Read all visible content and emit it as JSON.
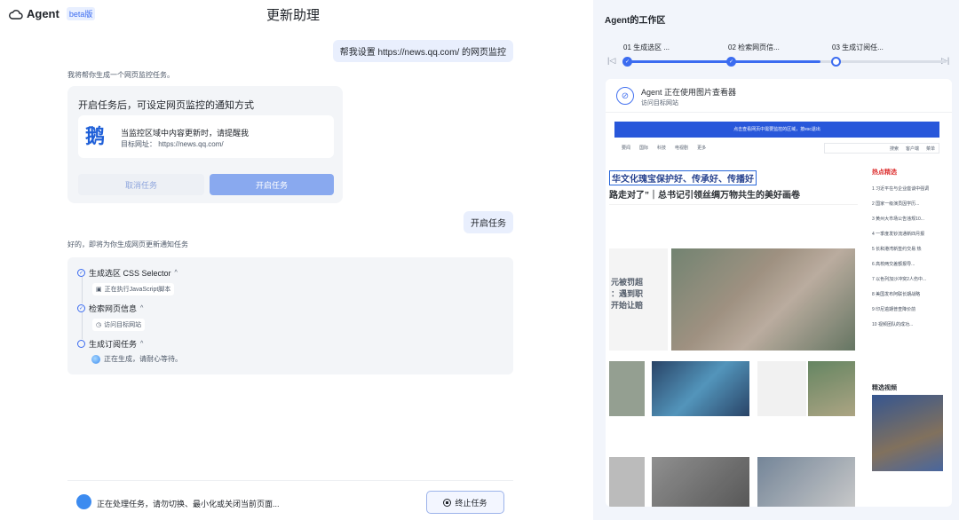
{
  "brand": {
    "name": "Agent",
    "badge": "beta版"
  },
  "page_title": "更新助理",
  "chat": {
    "user_msg_1": "帮我设置 https://news.qq.com/ 的网页监控",
    "bot_msg_1": "我将帮你生成一个网页监控任务。",
    "card": {
      "title": "开启任务后，可设定网页监控的通知方式",
      "logo_text": "鹅",
      "line1": "当监控区域中内容更新时，请提醒我",
      "line2": "目标网址：  https://news.qq.com/",
      "cancel_label": "取消任务",
      "start_label": "开启任务"
    },
    "user_msg_2": "开启任务",
    "bot_msg_2": "好的，即将为你生成网页更新通知任务",
    "steps": [
      {
        "label": "生成选区 CSS Selector",
        "sub": "正在执行JavaScript脚本",
        "done": true
      },
      {
        "label": "检索网页信息",
        "sub": "访问目标网站",
        "done": true
      },
      {
        "label": "生成订阅任务",
        "sub": "正在生成，请耐心等待。",
        "done": false
      }
    ]
  },
  "bottom": {
    "status_text": "正在处理任务，请勿切换、最小化或关闭当前页面...",
    "stop_label": "终止任务"
  },
  "workspace": {
    "title": "Agent的工作区",
    "timeline": [
      {
        "label": "01 生成选区 ..."
      },
      {
        "label": "02 检索网页信..."
      },
      {
        "label": "03 生成订阅任..."
      }
    ],
    "progress": 0.61,
    "viewer": {
      "title": "Agent 正在使用图片查看器",
      "subtitle": "访问目标网站"
    },
    "site": {
      "banner": "点击查看网页中需要监控的区域，按esc退出",
      "nav": [
        "要闻",
        "国际",
        "科技",
        "电视剧",
        "更多"
      ],
      "search": "搜索",
      "client": "客户端",
      "menu": "菜单",
      "headline": "华文化瑰宝保护好、传承好、传播好",
      "subhead": "路走对了”｜总书记引领丝绸万物共生的美好画卷",
      "left_block": "元被罚超\n：遇到职\n开始让赔",
      "side_title": "热点精选",
      "side_list": [
        "1 习近平在与企业座谈中强调",
        "2 国家一级演员因学历...",
        "3 黄州大市场公告违规10...",
        "4 一季度发钞流通新四月报",
        "5 长和港湾新签约交易 热",
        "6 高校两交差额报导...",
        "7 以色列加沙冲突2人伤中...",
        "8 美国发布阿联长期战略",
        "9 印尼逾期普查降价前",
        "10 视频团队的成功..."
      ],
      "video_head": "精选视频"
    }
  }
}
